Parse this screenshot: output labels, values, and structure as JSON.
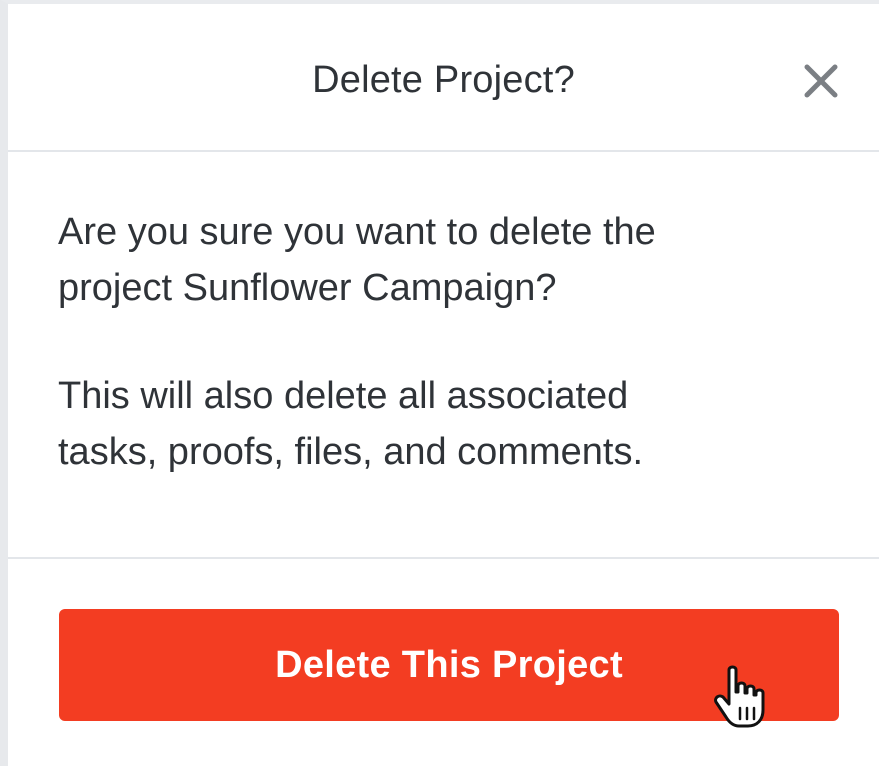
{
  "dialog": {
    "title": "Delete Project?",
    "close_icon": "close-icon",
    "message_line_1": "Are you sure you want to delete the",
    "message_line_2": "project Sunflower Campaign?",
    "warning_line_1": "This will also delete all associated",
    "warning_line_2": "tasks, proofs, files, and comments.",
    "delete_button_label": "Delete This Project"
  },
  "colors": {
    "danger": "#f33d22",
    "text": "#2f3338",
    "divider": "#e3e6ea"
  },
  "cursor_icon": "hand-pointer-icon"
}
